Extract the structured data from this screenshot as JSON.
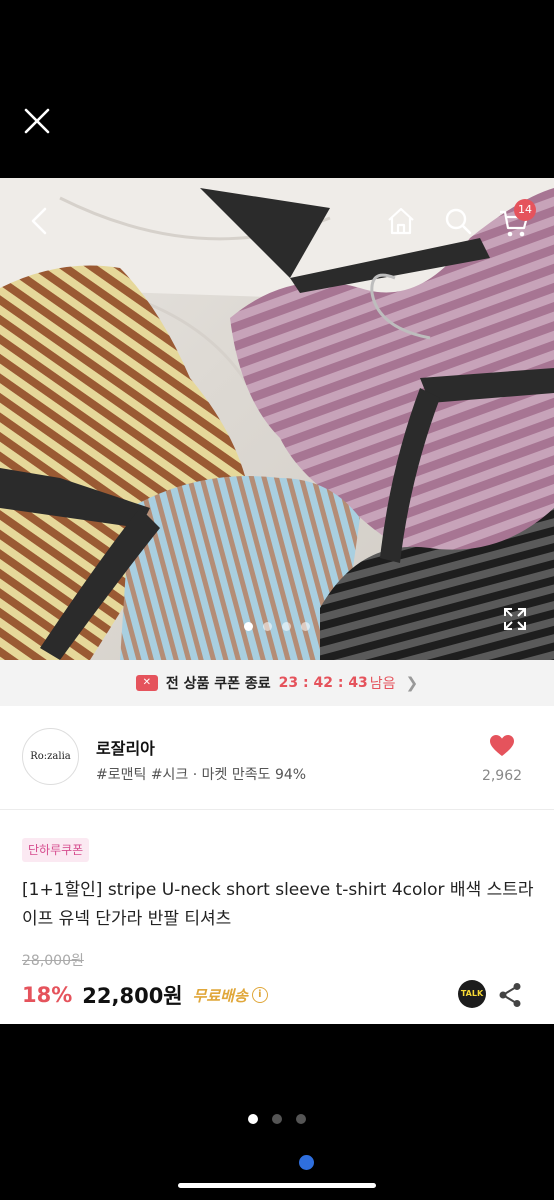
{
  "top": {
    "close_icon": "close-icon"
  },
  "hero": {
    "icons": [
      "back-arrow-icon",
      "home-icon",
      "search-icon",
      "cart-icon",
      "expand-icon"
    ],
    "cart_count": "14",
    "slide_count": 4,
    "active_slide": 0
  },
  "coupon_bar": {
    "label": "전 상품 쿠폰 종료",
    "timer": "23 : 42 : 43",
    "suffix": "남음"
  },
  "shop": {
    "logo_text": "Ro:zalia",
    "name": "로잘리아",
    "tags": "#로맨틱 #시크 · 마켓 만족도 94%",
    "likes": "2,962"
  },
  "product": {
    "badge": "단하루쿠폰",
    "title": "[1+1할인] stripe U-neck short sleeve t-shirt  4color 배색 스트라이프 유넥 단가라 반팔 티셔츠",
    "original_price": "28,000원",
    "discount": "18%",
    "price": "22,800원",
    "shipping": "무료배송",
    "talk_label": "TALK"
  },
  "pager": {
    "count": 3,
    "active": 0
  },
  "colors": {
    "accent": "#e5535c",
    "shipping": "#e0a73a",
    "badge_bg": "#fbe9f2",
    "badge_text": "#d64d8f",
    "blue_dot": "#2f6fde"
  }
}
